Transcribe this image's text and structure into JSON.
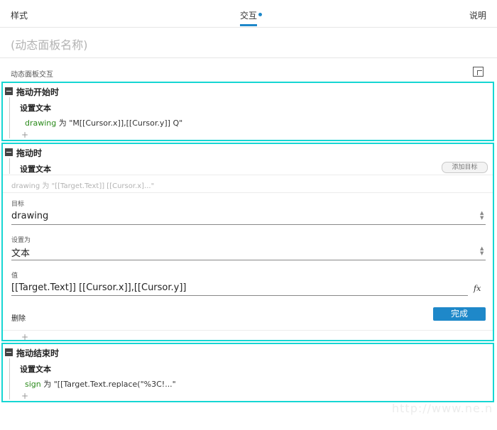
{
  "tabs": {
    "style": "样式",
    "interactions": "交互",
    "notes": "说明"
  },
  "panel_name_placeholder": "(动态面板名称)",
  "section_label": "动态面板交互",
  "events": [
    {
      "title": "拖动开始时",
      "action_title": "设置文本",
      "target": "drawing",
      "value_text": " 为 \"M[[Cursor.x]],[[Cursor.y]] Q\""
    },
    {
      "title": "拖动时",
      "action_title": "设置文本",
      "add_target_label": "添加目标",
      "summary": "drawing 为 \"[[Target.Text]] [[Cursor.x]...\"",
      "form": {
        "target_label": "目标",
        "target_value": "drawing",
        "set_as_label": "设置为",
        "set_as_value": "文本",
        "value_label": "值",
        "value_value": "[[Target.Text]] [[Cursor.x]],[[Cursor.y]]",
        "delete_label": "删除",
        "done_label": "完成"
      }
    },
    {
      "title": "拖动结束时",
      "action_title": "设置文本",
      "target": "sign",
      "value_text": " 为 \"[[Target.Text.replace(\"%3C!...\""
    }
  ],
  "plus_symbol": "+",
  "fx_symbol": "fx",
  "watermark": "http://www.ne.n",
  "colors": {
    "accent": "#1e88c9",
    "event_border": "#16d6d3",
    "target_green": "#2a8a1a"
  }
}
